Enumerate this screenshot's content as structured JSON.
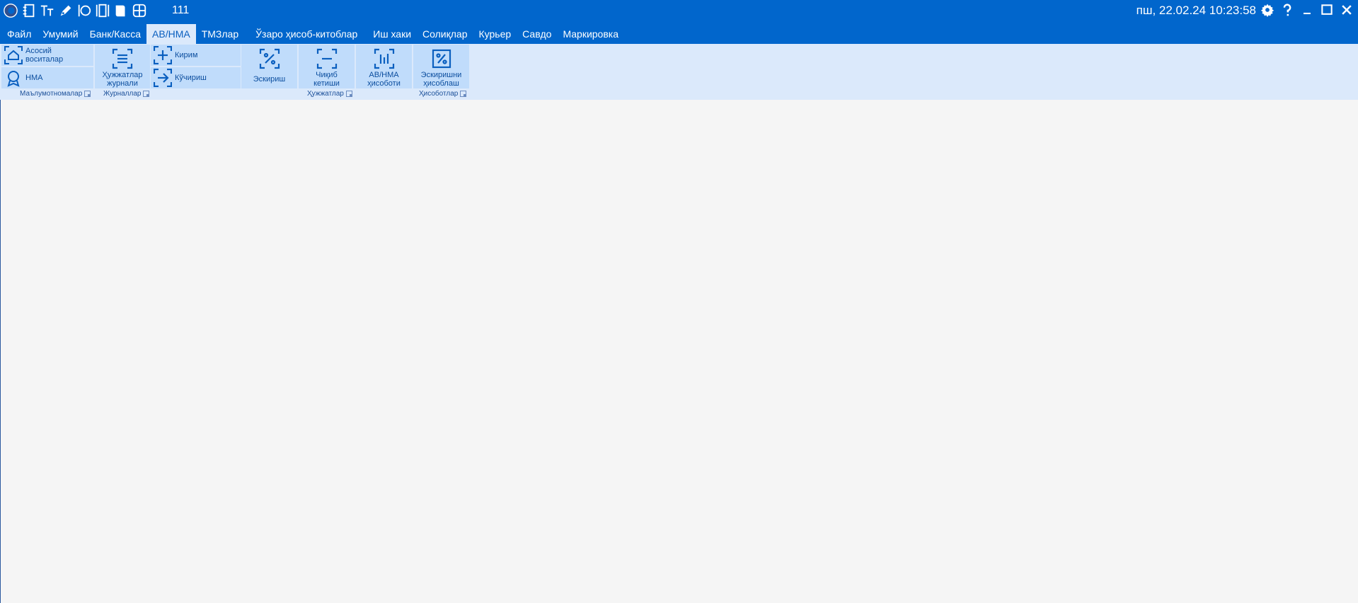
{
  "titlebar": {
    "counter": "111",
    "datetime": "пш, 22.02.24 10:23:58",
    "quick_icons": [
      "app-logo-icon",
      "notebook-icon",
      "font-size-icon",
      "pen-icon",
      "fork-knife-icon",
      "columns-icon",
      "book-icon",
      "grid-icon"
    ],
    "window_icons": [
      "gear-icon",
      "help-icon",
      "minimize-icon",
      "maximize-icon",
      "close-icon"
    ]
  },
  "menu": {
    "tabs": [
      {
        "label": "Файл"
      },
      {
        "label": "Умумий"
      },
      {
        "label": "Банк/Касса"
      },
      {
        "label": "АВ/НМА"
      },
      {
        "label": "ТМЗлар"
      },
      {
        "label": "Ўзаро ҳисоб-китоблар"
      },
      {
        "label": "Иш хаки"
      },
      {
        "label": "Солиқлар"
      },
      {
        "label": "Курьер"
      },
      {
        "label": "Савдо"
      },
      {
        "label": "Маркировка"
      }
    ],
    "active_tab": "АВ/НМА"
  },
  "ribbon": {
    "buttons": {
      "asosiy": {
        "line1": "Асосий",
        "line2": "воситалар"
      },
      "nma": {
        "label": "НМА"
      },
      "hujjat_jurnali": {
        "line1": "Ҳужжатлар",
        "line2": "журнали"
      },
      "kirim": {
        "label": "Кирим"
      },
      "kuchirish": {
        "label": "Кўчириш"
      },
      "eskirish": {
        "label": "Эскириш"
      },
      "chiqib": {
        "line1": "Чиқиб",
        "line2": "кетиши"
      },
      "av_hisoboti": {
        "line1": "АВ/НМА",
        "line2": "ҳисоботи"
      },
      "eskirish_hisob": {
        "line1": "Эскиришни",
        "line2": "ҳисоблаш"
      }
    },
    "groups": {
      "malumotnomalar": "Маълумотномалар",
      "jurnallar": "Журналлар",
      "hujjatlar": "Ҳужжатлар",
      "hisobotlar": "Ҳисоботлар"
    }
  },
  "colors": {
    "titlebar": "#0166cc",
    "ribbon": "#dbe9fb",
    "button": "#c0dcfb",
    "canvas": "#f5f5f5"
  }
}
